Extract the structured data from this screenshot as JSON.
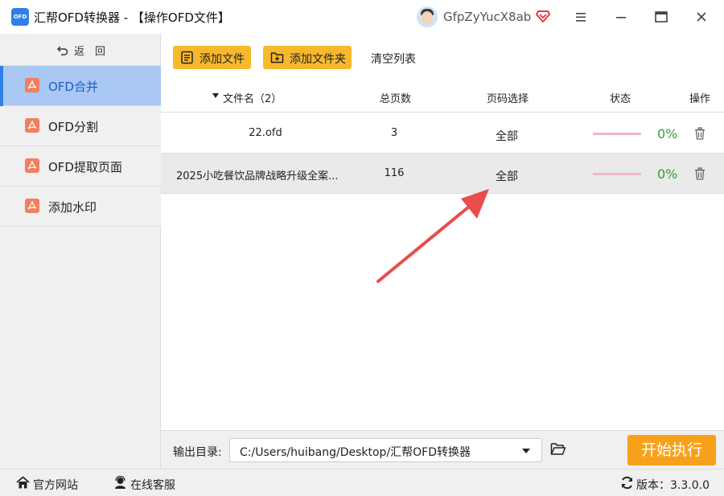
{
  "window": {
    "logo_text": "OFD",
    "title": "汇帮OFD转换器 - 【操作OFD文件】",
    "username": "GfpZyYucX8ab"
  },
  "sidebar": {
    "back_label": "返　回",
    "items": [
      {
        "label": "OFD合并",
        "active": true
      },
      {
        "label": "OFD分割",
        "active": false
      },
      {
        "label": "OFD提取页面",
        "active": false
      },
      {
        "label": "添加水印",
        "active": false
      }
    ]
  },
  "toolbar": {
    "add_file_label": "添加文件",
    "add_folder_label": "添加文件夹",
    "clear_label": "清空列表"
  },
  "table": {
    "headers": {
      "name": "文件名（2）",
      "pages": "总页数",
      "range": "页码选择",
      "status": "状态",
      "ops": "操作"
    },
    "rows": [
      {
        "name": "22.ofd",
        "pages": "3",
        "range": "全部",
        "progress": 0,
        "percent": "0%"
      },
      {
        "name": "2025小吃餐饮品牌战略升级全案...",
        "pages": "116",
        "range": "全部",
        "progress": 0,
        "percent": "0%"
      }
    ]
  },
  "output": {
    "label": "输出目录:",
    "path": "C:/Users/huibang/Desktop/汇帮OFD转换器",
    "start_label": "开始执行"
  },
  "statusbar": {
    "website": "官方网站",
    "support": "在线客服",
    "version": "版本：3.3.0.0"
  },
  "colors": {
    "accent": "#2f7fe8",
    "toolbar_button": "#f7b82c",
    "start_button": "#f7a11a",
    "percent": "#2ca02c",
    "arrow": "#e84c4c"
  }
}
